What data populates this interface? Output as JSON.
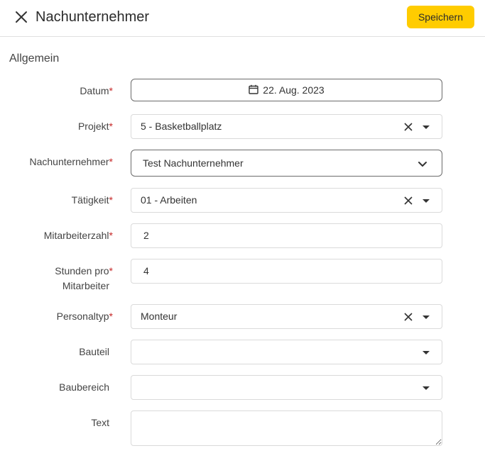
{
  "header": {
    "title": "Nachunternehmer",
    "save_label": "Speichern"
  },
  "section_title": "Allgemein",
  "required_marker": "*",
  "form": {
    "datum": {
      "label": "Datum",
      "value": "22. Aug. 2023"
    },
    "projekt": {
      "label": "Projekt",
      "value": "5 - Basketballplatz"
    },
    "nachunternehmer": {
      "label": "Nachunternehmer",
      "value": "Test Nachunternehmer"
    },
    "taetigkeit": {
      "label": "Tätigkeit",
      "value": "01 - Arbeiten"
    },
    "mitarbeiterzahl": {
      "label": "Mitarbeiterzahl",
      "value": "2"
    },
    "stunden": {
      "label_line1": "Stunden pro",
      "label_line2": "Mitarbeiter",
      "value": "4"
    },
    "personaltyp": {
      "label": "Personaltyp",
      "value": "Monteur"
    },
    "bauteil": {
      "label": "Bauteil",
      "value": ""
    },
    "baubereich": {
      "label": "Baubereich",
      "value": ""
    },
    "text": {
      "label": "Text",
      "value": ""
    }
  }
}
